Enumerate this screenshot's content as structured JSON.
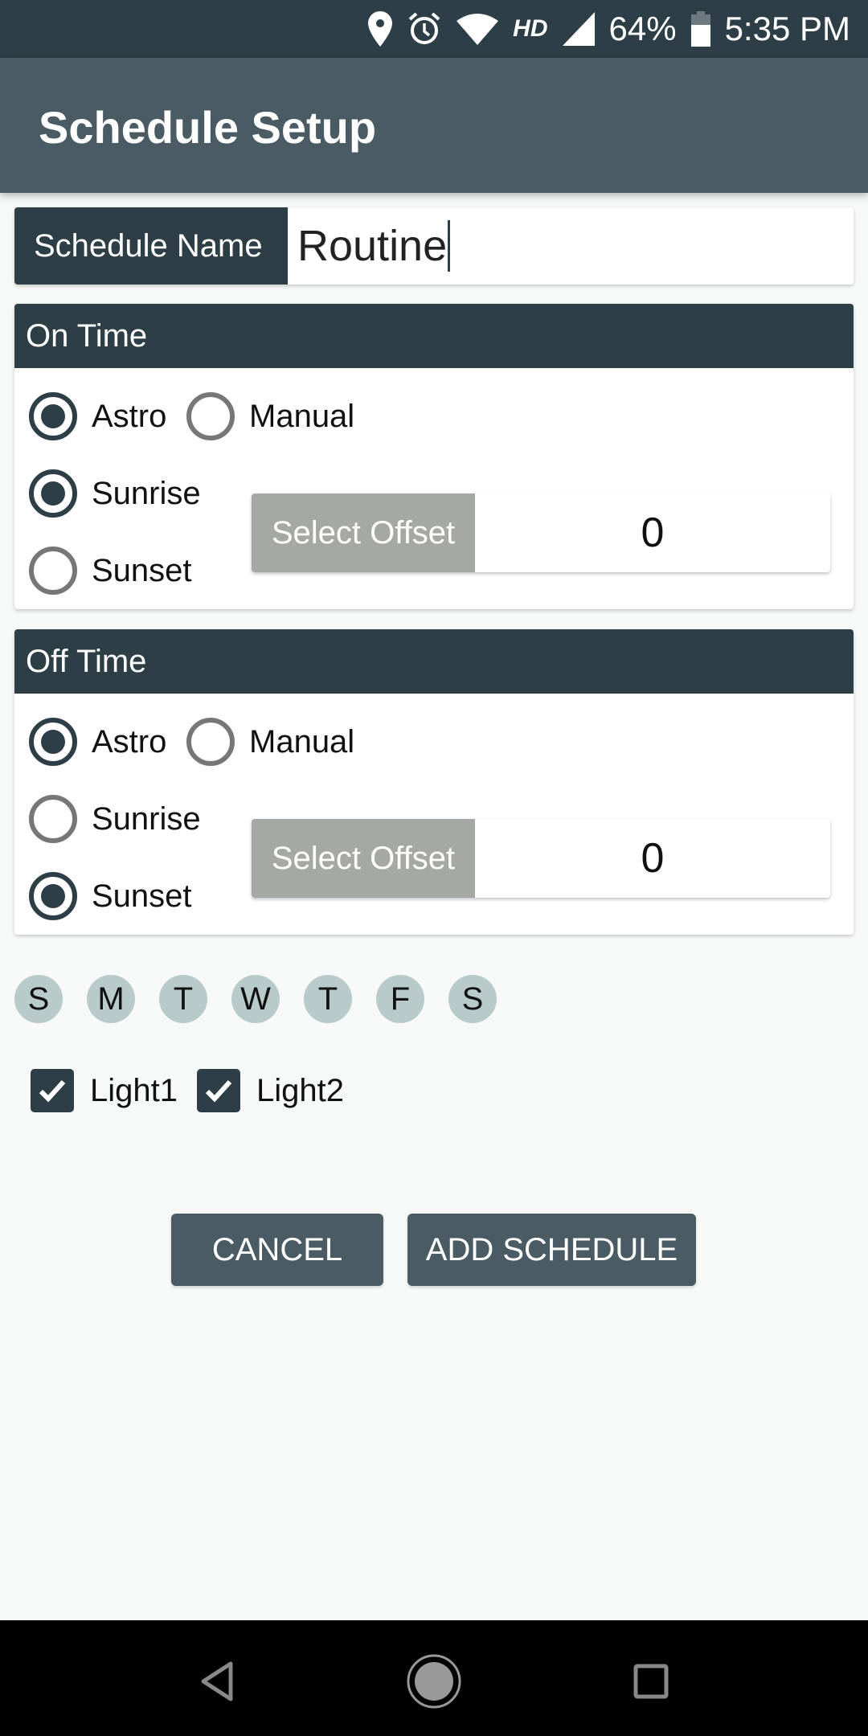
{
  "status_bar": {
    "icons": [
      "location-icon",
      "alarm-icon",
      "wifi-icon",
      "hd-indicator",
      "signal-icon",
      "battery-icon"
    ],
    "hd_label": "HD",
    "battery_percent": "64%",
    "time": "5:35 PM"
  },
  "app_bar": {
    "title": "Schedule Setup"
  },
  "schedule_name": {
    "label": "Schedule Name",
    "value": "Routine"
  },
  "on_time": {
    "title": "On Time",
    "mode_options": [
      {
        "label": "Astro",
        "checked": true
      },
      {
        "label": "Manual",
        "checked": false
      }
    ],
    "event_options": [
      {
        "label": "Sunrise",
        "checked": true
      },
      {
        "label": "Sunset",
        "checked": false
      }
    ],
    "offset_label": "Select Offset",
    "offset_value": "0"
  },
  "off_time": {
    "title": "Off Time",
    "mode_options": [
      {
        "label": "Astro",
        "checked": true
      },
      {
        "label": "Manual",
        "checked": false
      }
    ],
    "event_options": [
      {
        "label": "Sunrise",
        "checked": false
      },
      {
        "label": "Sunset",
        "checked": true
      }
    ],
    "offset_label": "Select Offset",
    "offset_value": "0"
  },
  "days": [
    "S",
    "M",
    "T",
    "W",
    "T",
    "F",
    "S"
  ],
  "lights": [
    {
      "label": "Light1",
      "checked": true
    },
    {
      "label": "Light2",
      "checked": true
    }
  ],
  "buttons": {
    "cancel": "CANCEL",
    "add": "ADD SCHEDULE"
  },
  "nav_bar": {
    "icons": [
      "back-icon",
      "home-icon",
      "recents-icon"
    ]
  }
}
